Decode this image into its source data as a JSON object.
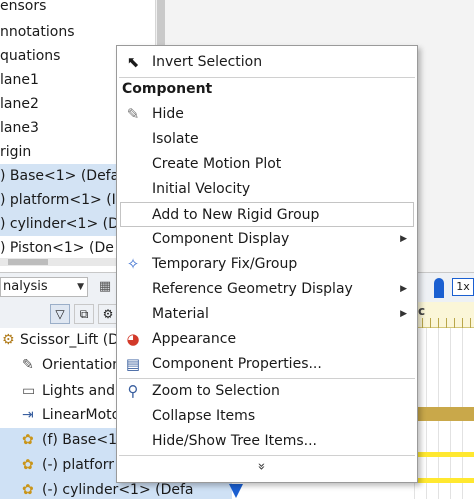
{
  "top_tree": {
    "items": [
      {
        "label": "ensors",
        "selected": false
      },
      {
        "label": "nnotations",
        "selected": false
      },
      {
        "label": "quations",
        "selected": false
      },
      {
        "label": "lane1",
        "selected": false
      },
      {
        "label": "lane2",
        "selected": false
      },
      {
        "label": "lane3",
        "selected": false
      },
      {
        "label": "rigin",
        "selected": false
      },
      {
        "label": ") Base<1> (Defa",
        "selected": true
      },
      {
        "label": ") platform<1> (I",
        "selected": true
      },
      {
        "label": ") cylinder<1> (D",
        "selected": true
      },
      {
        "label": ") Piston<1> (De",
        "selected": false
      }
    ]
  },
  "study_toolbar": {
    "analysis_value": "nalysis",
    "timeline_speed": "1x",
    "ruler_label": "c"
  },
  "lower_tree": {
    "items": [
      {
        "label": "Scissor_Lift (De",
        "icon": "assembly-icon",
        "selected": false
      },
      {
        "label": "Orientation",
        "icon": "pencil-icon",
        "selected": false
      },
      {
        "label": "Lights and",
        "icon": "folder-icon",
        "selected": false
      },
      {
        "label": "LinearMoto",
        "icon": "motor-icon",
        "selected": false
      },
      {
        "label": "(f) Base<1>",
        "icon": "part-icon",
        "selected": true
      },
      {
        "label": "(-) platforr",
        "icon": "part-icon",
        "selected": true
      },
      {
        "label": "(-) cylinder<1> (Defa",
        "icon": "part-icon",
        "selected": true
      }
    ]
  },
  "context_menu": {
    "invert_selection": "Invert Selection",
    "section_header": "Component",
    "hide": "Hide",
    "isolate": "Isolate",
    "create_motion_plot": "Create Motion Plot",
    "initial_velocity": "Initial Velocity",
    "add_to_rigid_group": "Add to New Rigid Group",
    "component_display": "Component Display",
    "temporary_fix": "Temporary Fix/Group",
    "reference_geometry_display": "Reference Geometry Display",
    "material": "Material",
    "appearance": "Appearance",
    "component_properties": "Component Properties...",
    "zoom_to_selection": "Zoom to Selection",
    "collapse_items": "Collapse Items",
    "hide_show_tree_items": "Hide/Show Tree Items...",
    "expand_glyph": "»"
  },
  "colors": {
    "selection": "#d3e3f4",
    "timeline_blue": "#1a5fd1",
    "gold_bar": "#c9a84a",
    "yellow_bar": "#ffe830"
  }
}
